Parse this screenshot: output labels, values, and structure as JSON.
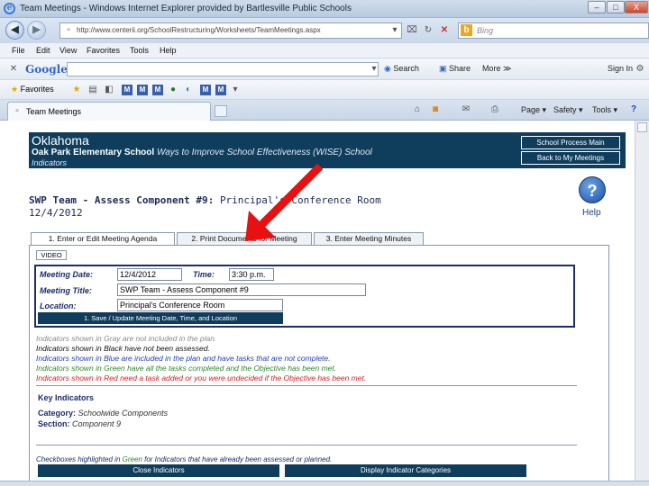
{
  "window": {
    "title": "Team Meetings - Windows Internet Explorer provided by Bartlesville Public Schools",
    "minimize": "–",
    "maximize": "□",
    "close": "X"
  },
  "address_bar": {
    "url": "http://www.centerii.org/SchoolRestructuring/Worksheets/TeamMeetings.aspx",
    "search_placeholder": "Bing"
  },
  "menu": [
    "File",
    "Edit",
    "View",
    "Favorites",
    "Tools",
    "Help"
  ],
  "google_bar": {
    "logo": "Google",
    "search_label": "Search",
    "share_label": "Share",
    "more_label": "More ≫",
    "signin_label": "Sign In"
  },
  "favorites_bar": {
    "favorites_label": "Favorites",
    "m_icons": [
      "M",
      "M",
      "M",
      "M",
      "M",
      "M"
    ]
  },
  "tab": {
    "label": "Team Meetings"
  },
  "command_bar": {
    "page": "Page ▾",
    "safety": "Safety ▾",
    "tools": "Tools ▾"
  },
  "banner": {
    "state": "Oklahoma",
    "school": "Oak Park Elementary School",
    "program": "Ways to Improve School Effectiveness (WISE)",
    "school_word": "School",
    "indicators_word": "Indicators",
    "btn_process_main": "School Process Main",
    "btn_my_meetings": "Back to My Meetings"
  },
  "meeting": {
    "heading": "SWP Team - Assess Component #9",
    "location_heading": "Principal's Conference Room",
    "date": "12/4/2012"
  },
  "help": {
    "icon": "?",
    "label": "Help"
  },
  "tabs": [
    {
      "label": "1. Enter or Edit Meeting Agenda"
    },
    {
      "label": "2. Print Documents for Meeting"
    },
    {
      "label": "3. Enter Meeting Minutes"
    }
  ],
  "form": {
    "video_label": "VIDEO",
    "date_label": "Meeting Date:",
    "date_value": "12/4/2012",
    "time_label": "Time:",
    "time_value": "3:30 p.m.",
    "title_label": "Meeting Title:",
    "title_value": "SWP Team - Assess Component #9",
    "location_label": "Location:",
    "location_value": "Principal's Conference Room",
    "save_button": "1. Save / Update Meeting Date, Time, and Location"
  },
  "legend": [
    {
      "text": "Indicators shown in Gray are not included in the plan.",
      "color": "#8a8a8a"
    },
    {
      "text": "Indicators shown in Black have not been assessed.",
      "color": "#111111"
    },
    {
      "text": "Indicators shown in Blue are included in the plan and have tasks that are not complete.",
      "color": "#1f3fbf"
    },
    {
      "text": "Indicators shown in Green have all the tasks completed and the Objective has been met.",
      "color": "#2a8a2a"
    },
    {
      "text": "Indicators shown in Red need a task added or you were undecided if the Objective has been met.",
      "color": "#d42020"
    }
  ],
  "key_indicators": {
    "heading": "Key Indicators",
    "category_label": "Category:",
    "category_value": "Schoolwide Components",
    "section_label": "Section:",
    "section_value": "Component 9"
  },
  "footer": {
    "checkbox_note_pre": "Checkboxes highlighted in",
    "checkbox_note_green": "Green",
    "checkbox_note_post": "for Indicators that have already been assessed or planned.",
    "close_indicators": "Close Indicators",
    "display_categories": "Display Indicator Categories"
  }
}
